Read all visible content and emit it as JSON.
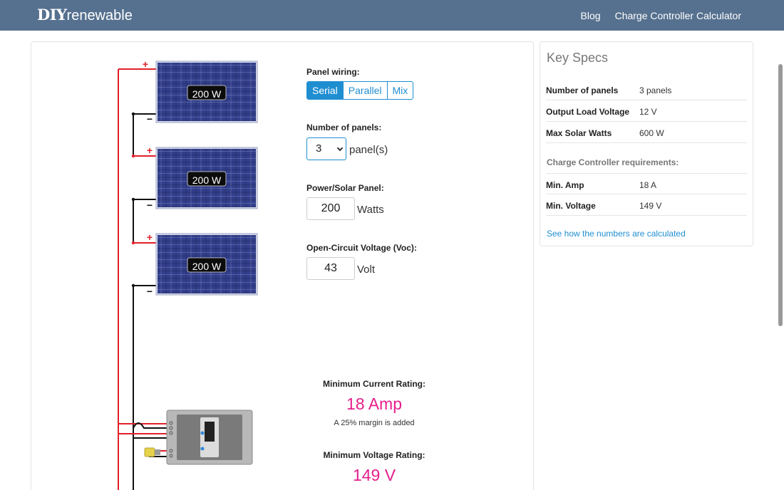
{
  "brand": {
    "part1": "DIY",
    "part2": "renewable"
  },
  "nav": {
    "blog": "Blog",
    "calculator": "Charge Controller Calculator"
  },
  "diagram": {
    "panels": [
      {
        "label": "200 W"
      },
      {
        "label": "200 W"
      },
      {
        "label": "200 W"
      }
    ],
    "plus_sign": "+",
    "minus_sign": "−"
  },
  "controls": {
    "wiring_label": "Panel wiring:",
    "wiring_options": [
      "Serial",
      "Parallel",
      "Mix"
    ],
    "wiring_selected": "Serial",
    "panels_label": "Number of panels:",
    "panels_value": "3",
    "panels_unit": "panel(s)",
    "power_label": "Power/Solar Panel:",
    "power_value": "200",
    "power_unit": "Watts",
    "voc_label": "Open-Circuit Voltage (Voc):",
    "voc_value": "43",
    "voc_unit": "Volt"
  },
  "ratings": {
    "current_title": "Minimum Current Rating:",
    "current_value": "18 Amp",
    "current_note": "A 25% margin is added",
    "voltage_title": "Minimum Voltage Rating:",
    "voltage_value": "149 V"
  },
  "specs": {
    "title": "Key Specs",
    "rows": [
      {
        "key": "Number of panels",
        "value": "3 panels"
      },
      {
        "key": "Output Load Voltage",
        "value": "12 V"
      },
      {
        "key": "Max Solar Watts",
        "value": "600 W"
      }
    ],
    "requirements_title": "Charge Controller requirements:",
    "req_rows": [
      {
        "key": "Min. Amp",
        "value": "18 A"
      },
      {
        "key": "Min. Voltage",
        "value": "149 V"
      }
    ],
    "link": "See how the numbers are calculated"
  },
  "colors": {
    "navbar": "#56718f",
    "accent": "#1f8ed1",
    "highlight": "#e61e8c",
    "wire_positive": "#e0202a",
    "wire_negative": "#111111",
    "panel": "#2a3370"
  }
}
